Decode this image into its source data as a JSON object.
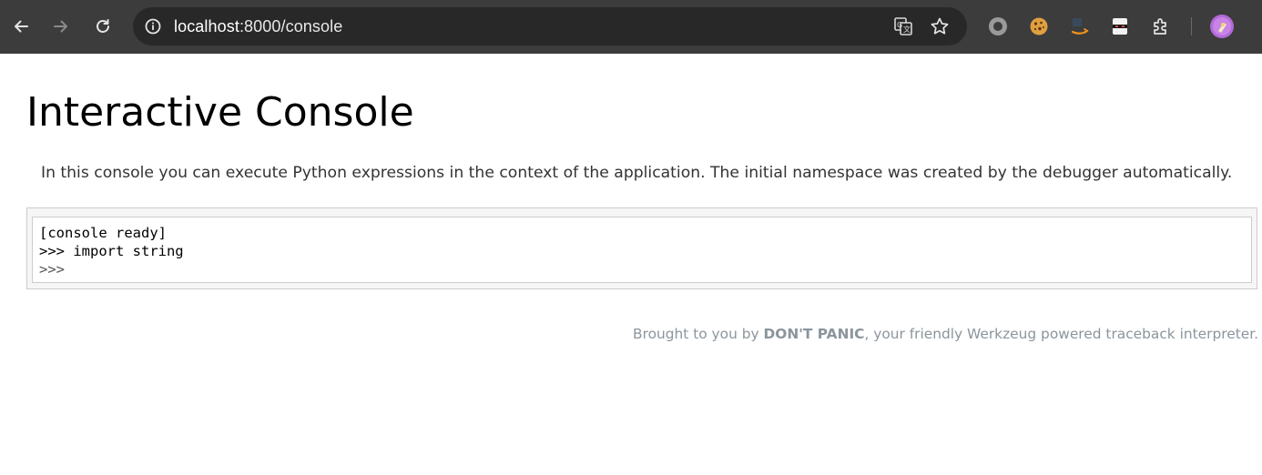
{
  "browser": {
    "url_host": "localhost",
    "url_path": ":8000/console"
  },
  "page": {
    "title": "Interactive Console",
    "explanation": "In this console you can execute Python expressions in the context of the application. The initial namespace was created by the debugger automatically.",
    "console": {
      "lines": [
        "[console ready]",
        ">>> import string"
      ],
      "prompt": ">>> "
    },
    "footer": {
      "prefix": "Brought to you by ",
      "brand": "DON'T PANIC",
      "suffix": ", your friendly Werkzeug powered traceback interpreter."
    }
  },
  "icons": {
    "back": "back-arrow-icon",
    "forward": "forward-arrow-icon",
    "reload": "reload-icon",
    "site_info": "info-icon",
    "translate": "translate-icon",
    "bookmark": "star-icon",
    "extensions": [
      "circle-extension-icon",
      "cookie-extension-icon",
      "aws-extension-icon",
      "note-extension-icon",
      "puzzle-extensions-icon"
    ],
    "profile": "avatar"
  },
  "colors": {
    "toolbar_bg": "#3c3c3c",
    "omnibox_bg": "#282828",
    "footer_text": "#8b959c",
    "avatar_bg": "#b26ad8"
  }
}
